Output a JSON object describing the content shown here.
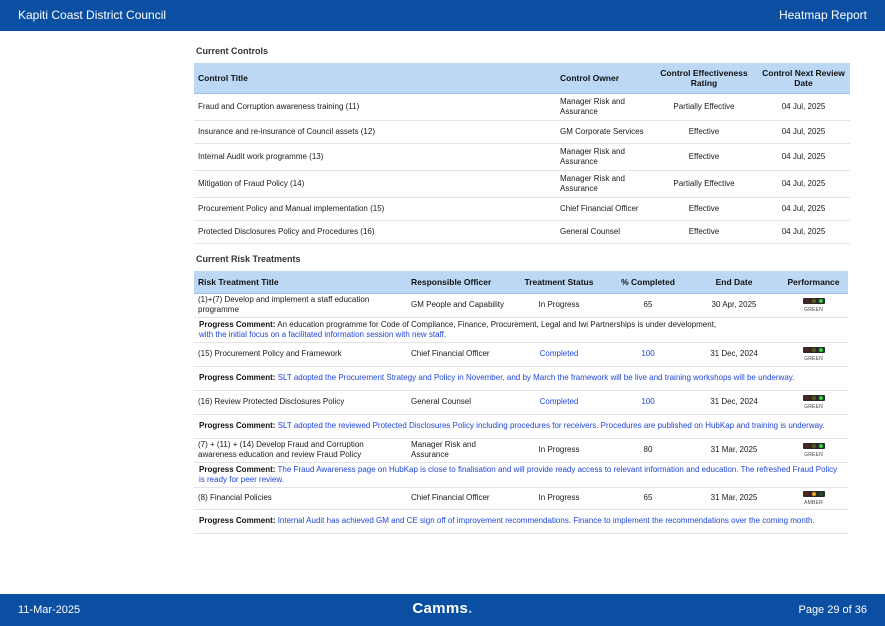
{
  "header": {
    "organization": "Kapiti Coast District Council",
    "report_name": "Heatmap Report"
  },
  "footer": {
    "date": "11-Mar-2025",
    "brand": "Camms",
    "brand_dot": ".",
    "page": "Page 29 of 36"
  },
  "current_controls": {
    "title": "Current Controls",
    "headers": {
      "title": "Control Title",
      "owner": "Control Owner",
      "rating": "Control Effectiveness Rating",
      "review": "Control Next Review Date"
    },
    "rows": [
      {
        "title": "Fraud and Corruption awareness training (11)",
        "owner": "Manager Risk and Assurance",
        "rating": "Partially Effective",
        "review": "04 Jul, 2025"
      },
      {
        "title": "Insurance and re-insurance of Council assets (12)",
        "owner": "GM Corporate Services",
        "rating": "Effective",
        "review": "04 Jul, 2025"
      },
      {
        "title": "Internal Audit work programme (13)",
        "owner": "Manager Risk and Assurance",
        "rating": "Effective",
        "review": "04 Jul, 2025"
      },
      {
        "title": "Mitigation of Fraud Policy (14)",
        "owner": "Manager Risk and Assurance",
        "rating": "Partially Effective",
        "review": "04 Jul, 2025"
      },
      {
        "title": "Procurement Policy and Manual implementation (15)",
        "owner": "Chief Financial Officer",
        "rating": "Effective",
        "review": "04 Jul, 2025"
      },
      {
        "title": "Protected Disclosures Policy and Procedures (16)",
        "owner": "General Counsel",
        "rating": "Effective",
        "review": "04 Jul, 2025"
      }
    ]
  },
  "current_treatments": {
    "title": "Current Risk Treatments",
    "headers": {
      "title": "Risk Treatment Title",
      "officer": "Responsible Officer",
      "status": "Treatment Status",
      "completed": "% Completed",
      "end": "End Date",
      "performance": "Performance"
    },
    "comment_label": "Progress Comment:",
    "rows": [
      {
        "title": "(1)+(7) Develop and implement a staff education programme",
        "officer": "GM People and Capability",
        "status": "In Progress",
        "completed": "65",
        "end": "30 Apr, 2025",
        "performance": "GREEN",
        "comment_black": "An education programme for Code of Compliance, Finance, Procurement, Legal and Iwi Partnerships is under development,",
        "comment_blue": "with the initial focus on a facilitated information session with new staff."
      },
      {
        "title": "(15) Procurement Policy and Framework",
        "officer": "Chief Financial Officer",
        "status": "Completed",
        "completed": "100",
        "end": "31 Dec, 2024",
        "performance": "GREEN",
        "comment_black": "",
        "comment_blue": "SLT adopted the Procurement Strategy and Policy in November, and by March the framework will be live and training workshops will be underway."
      },
      {
        "title": "(16) Review Protected Disclosures Policy",
        "officer": "General Counsel",
        "status": "Completed",
        "completed": "100",
        "end": "31 Dec, 2024",
        "performance": "GREEN",
        "comment_black": "",
        "comment_blue": "SLT adopted the reviewed Protected Disclosures Policy including procedures for receivers. Procedures are published on HubKap and training is underway."
      },
      {
        "title": "(7) + (11) + (14) Develop Fraud and Corruption awareness education and review Fraud Policy",
        "officer": "Manager Risk and Assurance",
        "status": "In Progress",
        "completed": "80",
        "end": "31 Mar, 2025",
        "performance": "GREEN",
        "comment_black": "",
        "comment_blue": "The Fraud Awareness page on HubKap is close to finalisation and will provide ready access to relevant information and education. The refreshed Fraud Policy is ready for peer review."
      },
      {
        "title": "(8) Financial Policies",
        "officer": "Chief Financial Officer",
        "status": "In Progress",
        "completed": "65",
        "end": "31 Mar, 2025",
        "performance": "AMBER",
        "comment_black": "",
        "comment_blue": "Internal Audit has achieved GM and CE sign off of improvement recommendations. Finance to implement the recommendations over the coming month."
      }
    ]
  }
}
